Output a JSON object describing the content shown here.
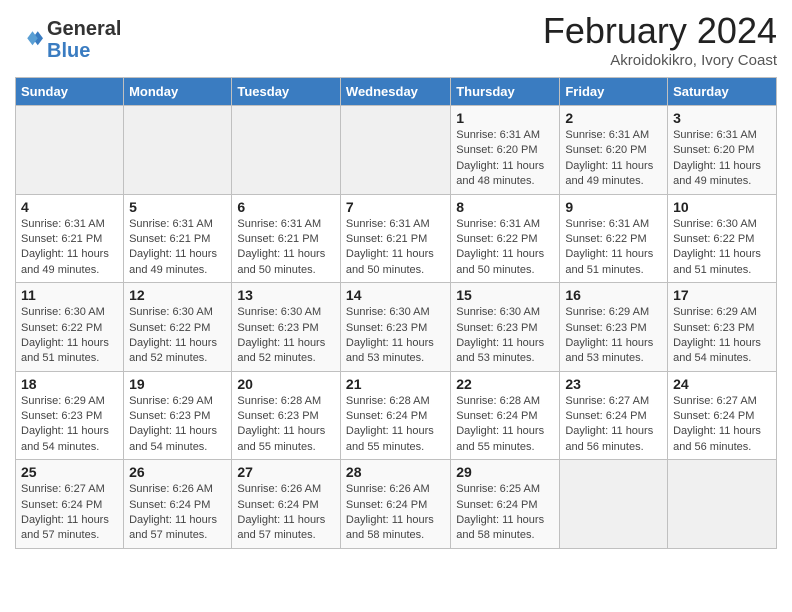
{
  "header": {
    "logo_general": "General",
    "logo_blue": "Blue",
    "month_year": "February 2024",
    "location": "Akroidokikro, Ivory Coast"
  },
  "columns": [
    "Sunday",
    "Monday",
    "Tuesday",
    "Wednesday",
    "Thursday",
    "Friday",
    "Saturday"
  ],
  "weeks": [
    [
      {
        "day": "",
        "info": ""
      },
      {
        "day": "",
        "info": ""
      },
      {
        "day": "",
        "info": ""
      },
      {
        "day": "",
        "info": ""
      },
      {
        "day": "1",
        "info": "Sunrise: 6:31 AM\nSunset: 6:20 PM\nDaylight: 11 hours\nand 48 minutes."
      },
      {
        "day": "2",
        "info": "Sunrise: 6:31 AM\nSunset: 6:20 PM\nDaylight: 11 hours\nand 49 minutes."
      },
      {
        "day": "3",
        "info": "Sunrise: 6:31 AM\nSunset: 6:20 PM\nDaylight: 11 hours\nand 49 minutes."
      }
    ],
    [
      {
        "day": "4",
        "info": "Sunrise: 6:31 AM\nSunset: 6:21 PM\nDaylight: 11 hours\nand 49 minutes."
      },
      {
        "day": "5",
        "info": "Sunrise: 6:31 AM\nSunset: 6:21 PM\nDaylight: 11 hours\nand 49 minutes."
      },
      {
        "day": "6",
        "info": "Sunrise: 6:31 AM\nSunset: 6:21 PM\nDaylight: 11 hours\nand 50 minutes."
      },
      {
        "day": "7",
        "info": "Sunrise: 6:31 AM\nSunset: 6:21 PM\nDaylight: 11 hours\nand 50 minutes."
      },
      {
        "day": "8",
        "info": "Sunrise: 6:31 AM\nSunset: 6:22 PM\nDaylight: 11 hours\nand 50 minutes."
      },
      {
        "day": "9",
        "info": "Sunrise: 6:31 AM\nSunset: 6:22 PM\nDaylight: 11 hours\nand 51 minutes."
      },
      {
        "day": "10",
        "info": "Sunrise: 6:30 AM\nSunset: 6:22 PM\nDaylight: 11 hours\nand 51 minutes."
      }
    ],
    [
      {
        "day": "11",
        "info": "Sunrise: 6:30 AM\nSunset: 6:22 PM\nDaylight: 11 hours\nand 51 minutes."
      },
      {
        "day": "12",
        "info": "Sunrise: 6:30 AM\nSunset: 6:22 PM\nDaylight: 11 hours\nand 52 minutes."
      },
      {
        "day": "13",
        "info": "Sunrise: 6:30 AM\nSunset: 6:23 PM\nDaylight: 11 hours\nand 52 minutes."
      },
      {
        "day": "14",
        "info": "Sunrise: 6:30 AM\nSunset: 6:23 PM\nDaylight: 11 hours\nand 53 minutes."
      },
      {
        "day": "15",
        "info": "Sunrise: 6:30 AM\nSunset: 6:23 PM\nDaylight: 11 hours\nand 53 minutes."
      },
      {
        "day": "16",
        "info": "Sunrise: 6:29 AM\nSunset: 6:23 PM\nDaylight: 11 hours\nand 53 minutes."
      },
      {
        "day": "17",
        "info": "Sunrise: 6:29 AM\nSunset: 6:23 PM\nDaylight: 11 hours\nand 54 minutes."
      }
    ],
    [
      {
        "day": "18",
        "info": "Sunrise: 6:29 AM\nSunset: 6:23 PM\nDaylight: 11 hours\nand 54 minutes."
      },
      {
        "day": "19",
        "info": "Sunrise: 6:29 AM\nSunset: 6:23 PM\nDaylight: 11 hours\nand 54 minutes."
      },
      {
        "day": "20",
        "info": "Sunrise: 6:28 AM\nSunset: 6:23 PM\nDaylight: 11 hours\nand 55 minutes."
      },
      {
        "day": "21",
        "info": "Sunrise: 6:28 AM\nSunset: 6:24 PM\nDaylight: 11 hours\nand 55 minutes."
      },
      {
        "day": "22",
        "info": "Sunrise: 6:28 AM\nSunset: 6:24 PM\nDaylight: 11 hours\nand 55 minutes."
      },
      {
        "day": "23",
        "info": "Sunrise: 6:27 AM\nSunset: 6:24 PM\nDaylight: 11 hours\nand 56 minutes."
      },
      {
        "day": "24",
        "info": "Sunrise: 6:27 AM\nSunset: 6:24 PM\nDaylight: 11 hours\nand 56 minutes."
      }
    ],
    [
      {
        "day": "25",
        "info": "Sunrise: 6:27 AM\nSunset: 6:24 PM\nDaylight: 11 hours\nand 57 minutes."
      },
      {
        "day": "26",
        "info": "Sunrise: 6:26 AM\nSunset: 6:24 PM\nDaylight: 11 hours\nand 57 minutes."
      },
      {
        "day": "27",
        "info": "Sunrise: 6:26 AM\nSunset: 6:24 PM\nDaylight: 11 hours\nand 57 minutes."
      },
      {
        "day": "28",
        "info": "Sunrise: 6:26 AM\nSunset: 6:24 PM\nDaylight: 11 hours\nand 58 minutes."
      },
      {
        "day": "29",
        "info": "Sunrise: 6:25 AM\nSunset: 6:24 PM\nDaylight: 11 hours\nand 58 minutes."
      },
      {
        "day": "",
        "info": ""
      },
      {
        "day": "",
        "info": ""
      }
    ]
  ]
}
